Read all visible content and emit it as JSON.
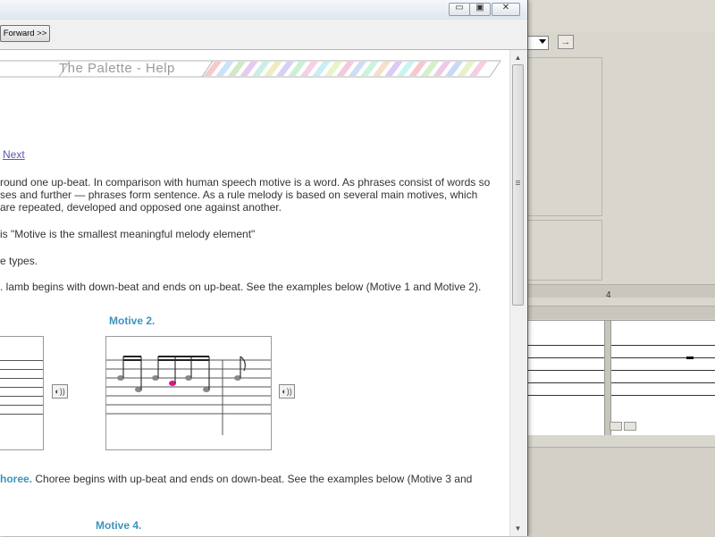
{
  "window": {
    "title": "",
    "controls": {
      "minimize": "▭",
      "maximize": "▣",
      "close": "✕"
    }
  },
  "toolbar": {
    "forward_label": "Forward >>"
  },
  "help": {
    "banner_title": "The Palette - Help",
    "next_link": "Next",
    "paragraphs": [
      "round one up-beat. In comparison with human speech motive is a word. As phrases consist of words so",
      "ses and further — phrases form sentence. As a rule melody is based on several main motives, which",
      "are repeated, developed and opposed one against another.",
      "is \"Motive is the smallest meaningful melody element\"",
      "e types.",
      ". lamb begins with down-beat and ends on up-beat. See the examples below (Motive 1 and Motive 2)."
    ],
    "motive2_caption": "Motive 2.",
    "choree_lead": "horee.",
    "choree_text_1": " Choree begins with up-beat and ends on down-beat. See the examples below (Motive 3 and",
    "motive4_caption": "Motive 4.",
    "play_icon_glyph": "◐))"
  },
  "background_app": {
    "nav_arrow": "→",
    "counter": "4"
  },
  "colors": {
    "accent": "#3c94be",
    "link": "#5a5ab0",
    "highlight_note": "#e0167a"
  }
}
